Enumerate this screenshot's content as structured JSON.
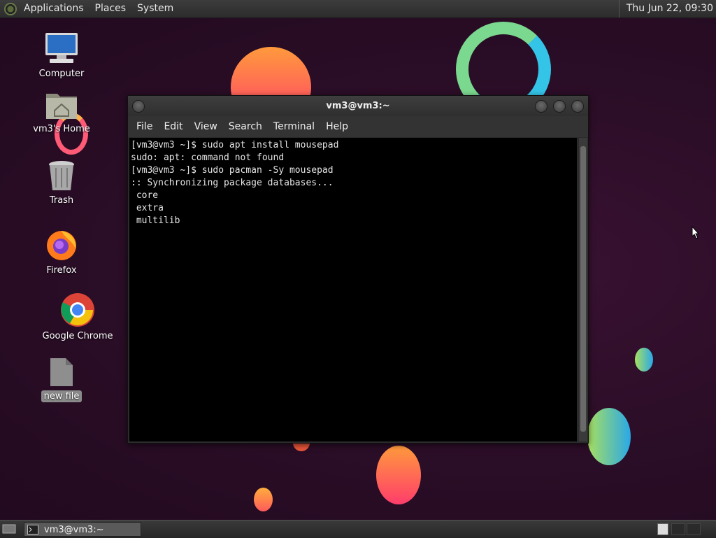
{
  "top_panel": {
    "menus": [
      "Applications",
      "Places",
      "System"
    ],
    "clock": "Thu Jun 22, 09:30"
  },
  "desktop_icons": [
    {
      "label": "Computer"
    },
    {
      "label": "vm3's Home"
    },
    {
      "label": "Trash"
    },
    {
      "label": "Firefox"
    },
    {
      "label": "Google Chrome"
    },
    {
      "label": "new file"
    }
  ],
  "terminal": {
    "title": "vm3@vm3:~",
    "menu": [
      "File",
      "Edit",
      "View",
      "Search",
      "Terminal",
      "Help"
    ],
    "lines": [
      "[vm3@vm3 ~]$ sudo apt install mousepad",
      "sudo: apt: command not found",
      "[vm3@vm3 ~]$ sudo pacman -Sy mousepad",
      ":: Synchronizing package databases...",
      " core",
      " extra",
      " multilib"
    ]
  },
  "taskbar": {
    "task_label": "vm3@vm3:~"
  }
}
